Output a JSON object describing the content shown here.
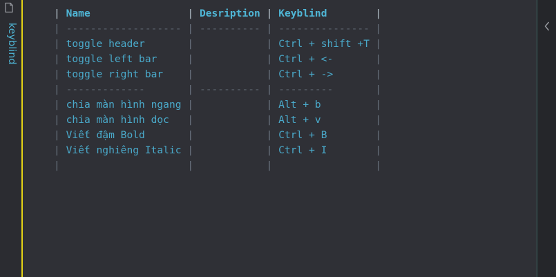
{
  "sidebar": {
    "label": "keyblind"
  },
  "table": {
    "headers": [
      "Name",
      "Desription",
      "Keyblind"
    ],
    "header_separator": [
      "-------------------",
      "----------",
      "---------------"
    ],
    "rows_group1": [
      [
        "toggle header",
        "",
        "Ctrl + shift +T"
      ],
      [
        "toggle left bar",
        "",
        "Ctrl + <-"
      ],
      [
        "toggle right bar",
        "",
        "Ctrl + ->"
      ]
    ],
    "group_separator": [
      "-------------",
      "----------",
      "---------"
    ],
    "rows_group2": [
      [
        "chia màn hình ngang",
        "",
        "Alt + b"
      ],
      [
        "chia màn hình dọc",
        "",
        "Alt + v"
      ],
      [
        "Viết đậm Bold",
        "",
        "Ctrl + B"
      ],
      [
        "Viết nghiêng Italic",
        "",
        "Ctrl + I"
      ]
    ]
  },
  "colors": {
    "accent": "#4fb6d6",
    "background": "#2f3036",
    "yellow_rule": "#e5d415"
  },
  "icons": {
    "file": "file-icon",
    "collapse": "chevron-left-icon"
  }
}
